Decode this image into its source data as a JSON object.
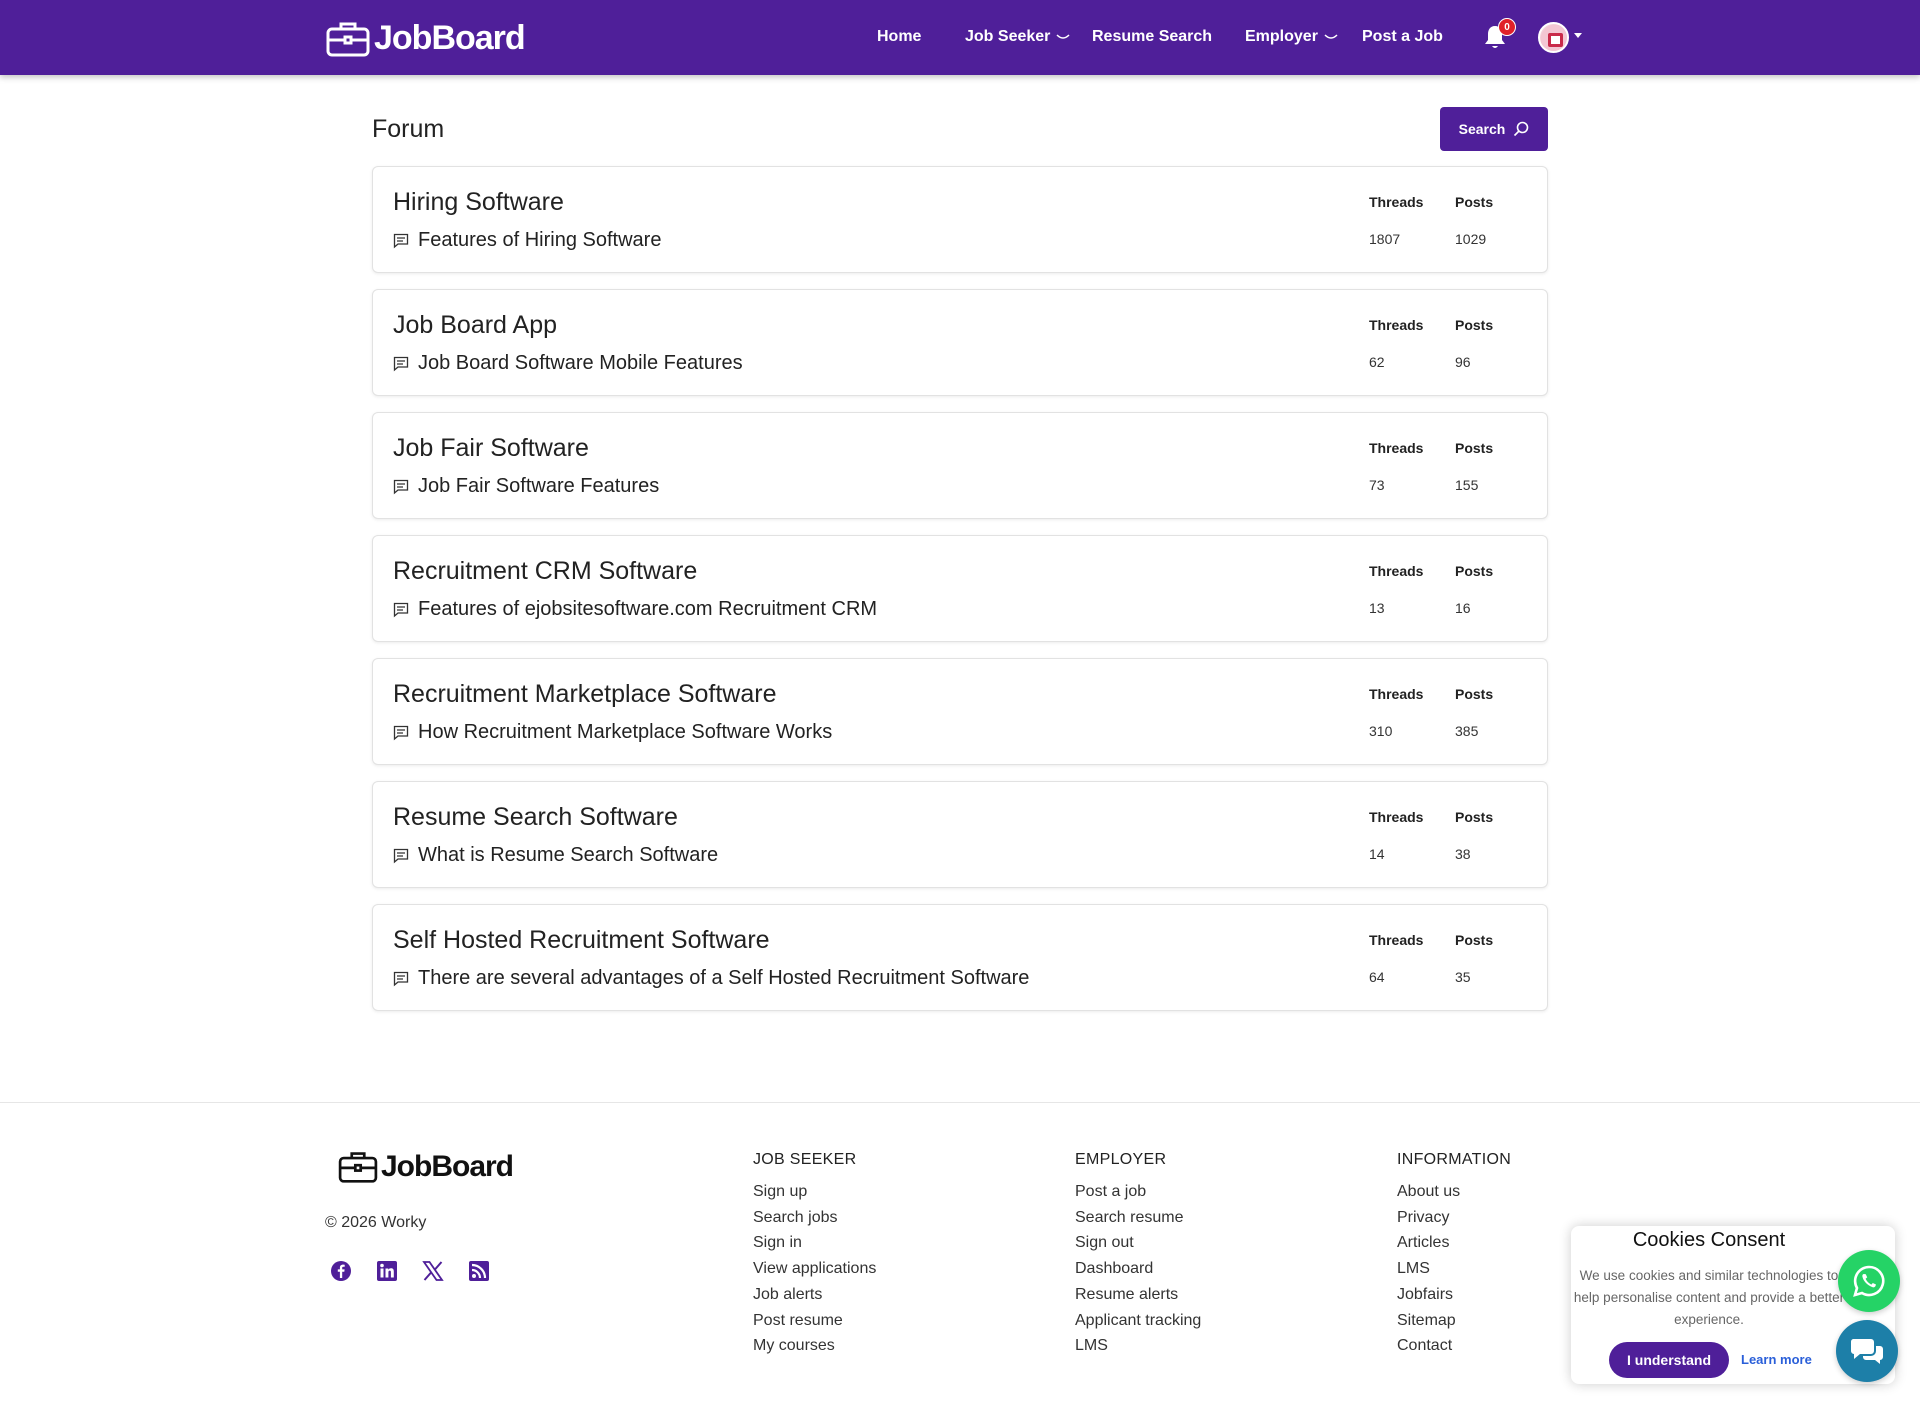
{
  "brand": {
    "name": "JobBoard"
  },
  "nav": {
    "home": "Home",
    "job_seeker": "Job Seeker",
    "resume_search": "Resume Search",
    "employer": "Employer",
    "post_job": "Post a Job",
    "notification_count": "0"
  },
  "page": {
    "title": "Forum",
    "search_label": "Search"
  },
  "columns": {
    "threads": "Threads",
    "posts": "Posts"
  },
  "forums": [
    {
      "title": "Hiring Software",
      "subtitle": "Features of Hiring Software",
      "threads": "1807",
      "posts": "1029"
    },
    {
      "title": "Job Board App",
      "subtitle": "Job Board Software Mobile Features",
      "threads": "62",
      "posts": "96"
    },
    {
      "title": "Job Fair Software",
      "subtitle": "Job Fair Software Features",
      "threads": "73",
      "posts": "155"
    },
    {
      "title": "Recruitment CRM Software",
      "subtitle": "Features of ejobsitesoftware.com Recruitment CRM",
      "threads": "13",
      "posts": "16"
    },
    {
      "title": "Recruitment Marketplace Software",
      "subtitle": "How Recruitment Marketplace Software Works",
      "threads": "310",
      "posts": "385"
    },
    {
      "title": "Resume Search Software",
      "subtitle": "What is Resume Search Software",
      "threads": "14",
      "posts": "38"
    },
    {
      "title": "Self Hosted Recruitment Software",
      "subtitle": "There are several advantages of a Self Hosted Recruitment Software",
      "threads": "64",
      "posts": "35"
    }
  ],
  "footer": {
    "copyright": "© 2026 Worky",
    "job_seeker": {
      "heading": "JOB SEEKER",
      "links": [
        "Sign up",
        "Search jobs",
        "Sign in",
        "View applications",
        "Job alerts",
        "Post resume",
        "My courses"
      ]
    },
    "employer": {
      "heading": "EMPLOYER",
      "links": [
        "Post a job",
        "Search resume",
        "Sign out",
        "Dashboard",
        "Resume alerts",
        "Applicant tracking",
        "LMS"
      ]
    },
    "information": {
      "heading": "INFORMATION",
      "links": [
        "About us",
        "Privacy",
        "Articles",
        "LMS",
        "Jobfairs",
        "Sitemap",
        "Contact"
      ]
    }
  },
  "cookie": {
    "title": "Cookies Consent",
    "text": "We use cookies and similar technologies to help personalise content and provide a better experience.",
    "accept": "I understand",
    "learn_more": "Learn more"
  },
  "colors": {
    "brand": "#4f1f99",
    "badge": "#e0202a",
    "whatsapp": "#25d366",
    "chat": "#1d7fa8"
  },
  "icons": [
    "briefcase-icon",
    "chevron-down-icon",
    "bell-icon",
    "avatar",
    "search-icon",
    "message-icon",
    "facebook-icon",
    "linkedin-icon",
    "x-icon",
    "rss-icon",
    "whatsapp-icon",
    "chat-icon"
  ]
}
